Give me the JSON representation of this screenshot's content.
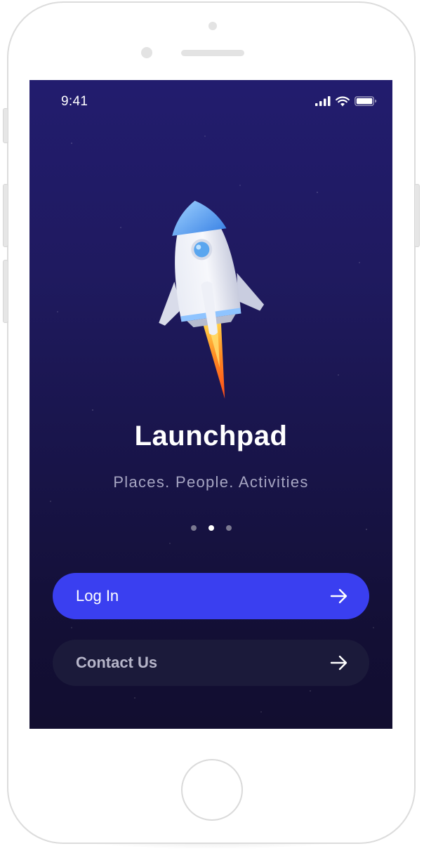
{
  "status_bar": {
    "time": "9:41"
  },
  "app": {
    "title": "Launchpad",
    "subtitle": "Places. People. Activities"
  },
  "pager": {
    "count": 3,
    "active_index": 1
  },
  "actions": {
    "login_label": "Log In",
    "contact_label": "Contact Us"
  },
  "colors": {
    "background_top": "#221c6e",
    "background_bottom": "#120e30",
    "primary_button": "#3a3ff0",
    "secondary_button": "#1b1a3a"
  },
  "icons": {
    "signal": "cellular-signal-icon",
    "wifi": "wifi-icon",
    "battery": "battery-icon",
    "hero": "rocket-icon",
    "button_arrow": "arrow-right-icon"
  }
}
